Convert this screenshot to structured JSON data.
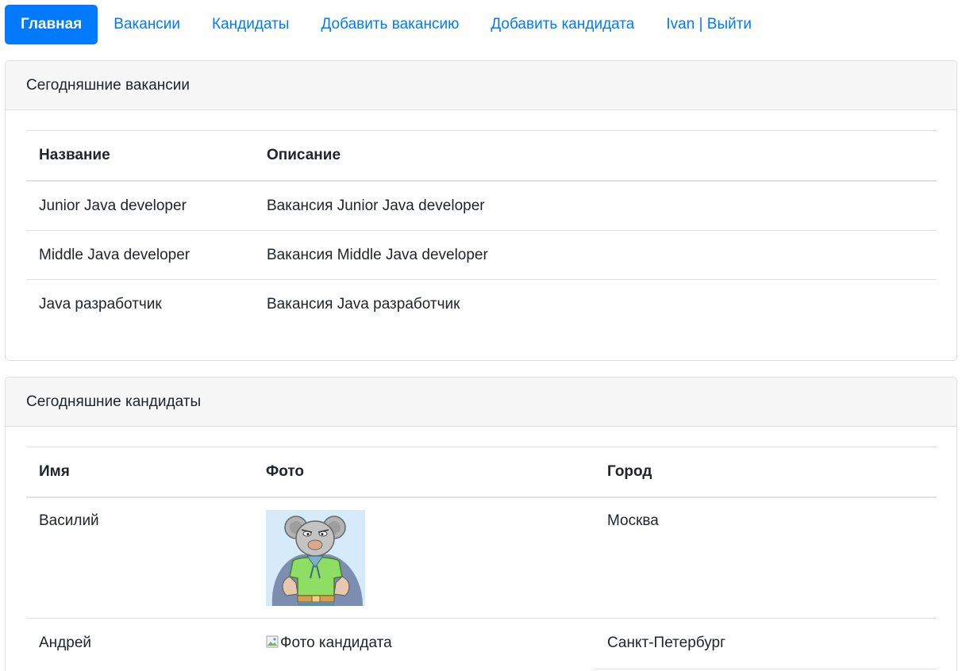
{
  "nav": {
    "items": [
      {
        "label": "Главная",
        "active": true
      },
      {
        "label": "Вакансии",
        "active": false
      },
      {
        "label": "Кандидаты",
        "active": false
      },
      {
        "label": "Добавить вакансию",
        "active": false
      },
      {
        "label": "Добавить кандидата",
        "active": false
      },
      {
        "label": "Ivan | Выйти",
        "active": false
      }
    ],
    "accent_color": "#007bff"
  },
  "vacancies": {
    "title": "Сегодняшние вакансии",
    "columns": [
      "Название",
      "Описание"
    ],
    "rows": [
      {
        "name": "Junior Java developer",
        "description": "Вакансия Junior Java developer"
      },
      {
        "name": "Middle Java developer",
        "description": "Вакансия Middle Java developer"
      },
      {
        "name": "Java разработчик",
        "description": "Вакансия Java разработчик"
      }
    ]
  },
  "candidates": {
    "title": "Сегодняшние кандидаты",
    "columns": [
      "Имя",
      "Фото",
      "Город"
    ],
    "rows": [
      {
        "name": "Василий",
        "photo": "cartoon-avatar",
        "city": "Москва"
      },
      {
        "name": "Андрей",
        "photo_alt": "Фото кандидата",
        "city": "Санкт-Петербург"
      }
    ]
  }
}
